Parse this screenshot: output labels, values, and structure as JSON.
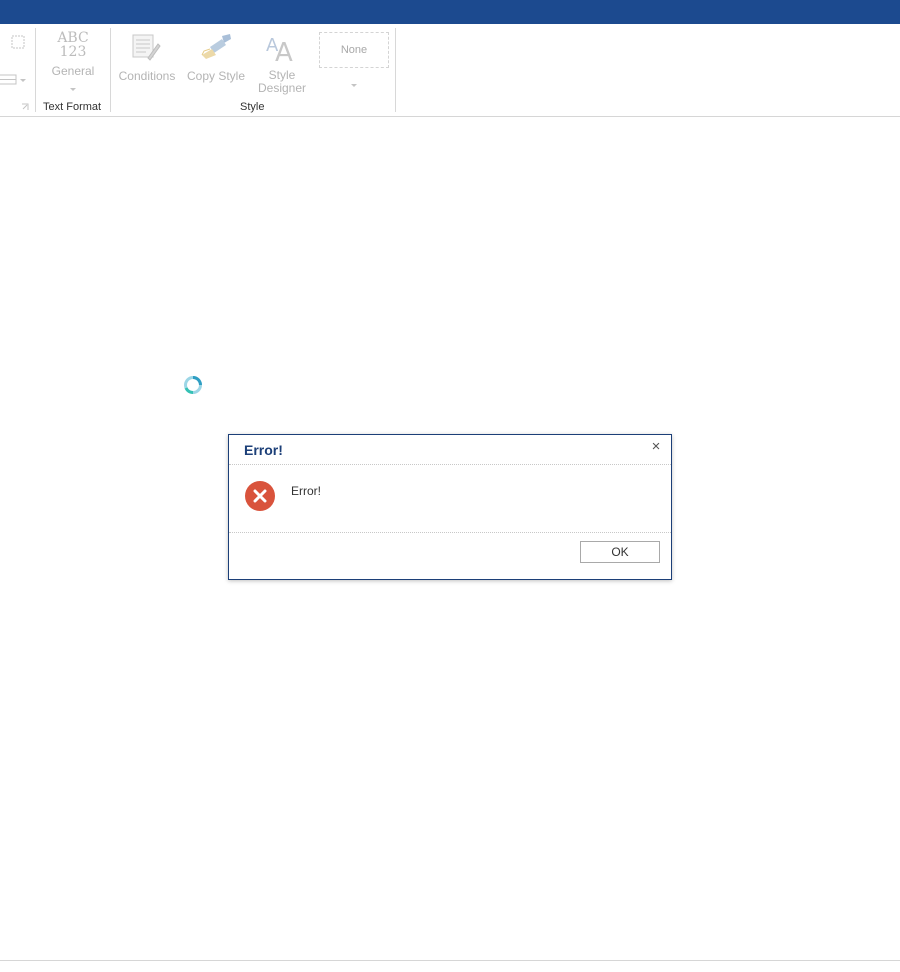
{
  "ribbon": {
    "text_format": {
      "icon_text_top": "ABC",
      "icon_text_bottom": "123",
      "format_label": "General",
      "group_label": "Text Format"
    },
    "style": {
      "conditions_label": "Conditions",
      "copy_style_label": "Copy Style",
      "style_designer_label_line1": "Style",
      "style_designer_label_line2": "Designer",
      "style_preset": "None",
      "group_label": "Style"
    }
  },
  "dialog": {
    "title": "Error!",
    "message": "Error!",
    "ok_label": "OK",
    "close_glyph": "×"
  },
  "icons": {
    "error_icon_color": "#d9533c",
    "title_color": "#1c3f78",
    "top_bar_color": "#1c4a8f"
  }
}
